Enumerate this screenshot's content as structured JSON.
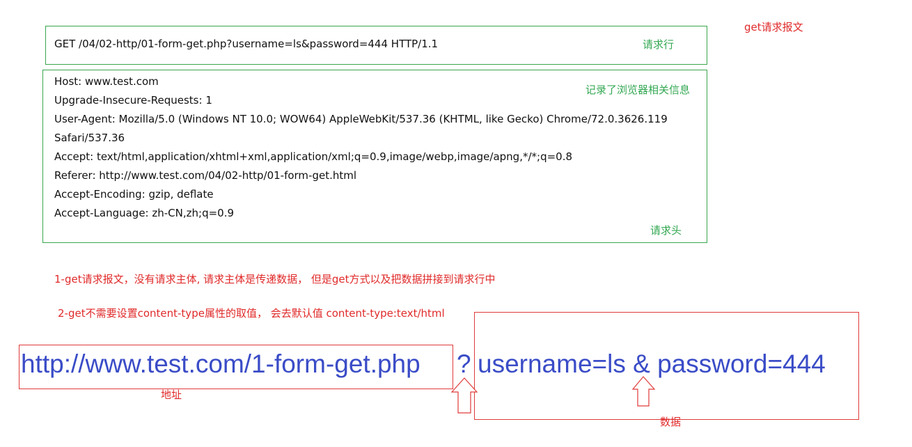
{
  "title": "get请求报文",
  "request_line": {
    "text": "GET /04/02-http/01-form-get.php?username=ls&password=444 HTTP/1.1",
    "label": "请求行"
  },
  "headers": {
    "note": "记录了浏览器相关信息",
    "label": "请求头",
    "lines": [
      "Host: www.test.com",
      "Upgrade-Insecure-Requests: 1",
      "User-Agent: Mozilla/5.0 (Windows NT 10.0; WOW64) AppleWebKit/537.36 (KHTML, like Gecko) Chrome/72.0.3626.119",
      "Safari/537.36",
      "Accept: text/html,application/xhtml+xml,application/xml;q=0.9,image/webp,image/apng,*/*;q=0.8",
      "Referer: http://www.test.com/04/02-http/01-form-get.html",
      "Accept-Encoding: gzip, deflate",
      "Accept-Language: zh-CN,zh;q=0.9"
    ]
  },
  "notes": {
    "note1": "1-get请求报文，没有请求主体, 请求主体是传递数据， 但是get方式以及把数据拼接到请求行中",
    "note2": "2-get不需要设置content-type属性的取值， 会去默认值 content-type:text/html"
  },
  "url_example": {
    "address": "http://www.test.com/1-form-get.php",
    "separator": "?",
    "data": "username=ls & password=444",
    "address_label": "地址",
    "data_label": "数据"
  },
  "colors": {
    "green": "#3aa64b",
    "red": "#e03a3a",
    "blue": "#3a4cc7"
  }
}
